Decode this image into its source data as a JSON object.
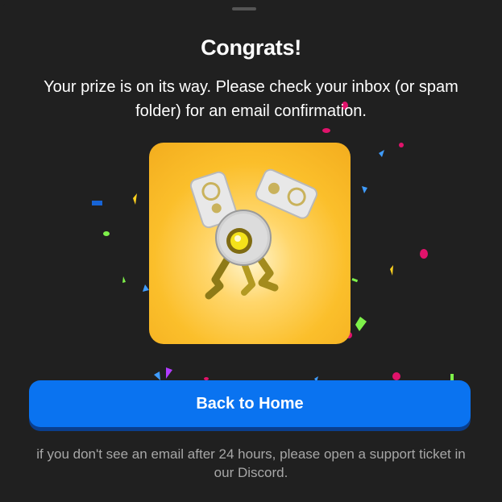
{
  "dialog": {
    "title": "Congrats!",
    "message": "Your prize is on its way. Please check your inbox (or spam folder) for an email confirmation.",
    "prize_image": "golden-bee-robot-item",
    "primary_button": "Back to Home",
    "footnote": "if you don't see an email after 24 hours, please open a support ticket in our Discord."
  },
  "colors": {
    "background": "#202020",
    "button": "#0a73f0",
    "prize_card": "#fbbf2b",
    "confetti": [
      "#e0136b",
      "#3f9cff",
      "#7ef14a",
      "#ffd21f",
      "#b33cff",
      "#1764d6"
    ]
  }
}
